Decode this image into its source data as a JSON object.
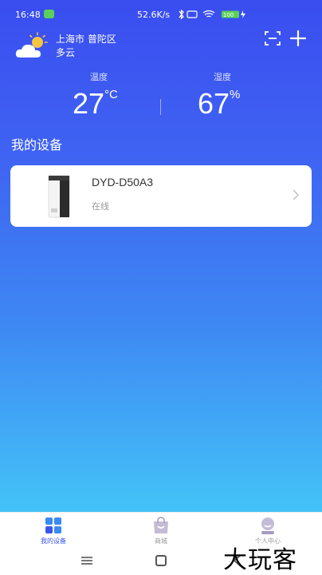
{
  "status_bar": {
    "time": "16:48",
    "network_speed": "52.6K/s",
    "battery": "100"
  },
  "weather": {
    "city": "上海市 普陀区",
    "condition": "多云",
    "icon": "partly-cloudy-icon"
  },
  "climate": {
    "temperature_label": "温度",
    "temperature_value": "27",
    "temperature_unit": "°C",
    "humidity_label": "湿度",
    "humidity_value": "67",
    "humidity_unit": "%"
  },
  "devices_section": {
    "title": "我的设备",
    "devices": [
      {
        "name": "DYD-D50A3",
        "status": "在线",
        "icon": "dehumidifier-icon"
      }
    ]
  },
  "bottom_nav": {
    "items": [
      {
        "label": "我的设备",
        "icon": "grid-icon",
        "active": true
      },
      {
        "label": "商城",
        "icon": "shopping-bag-icon",
        "active": false
      },
      {
        "label": "个人中心",
        "icon": "profile-icon",
        "active": false
      }
    ]
  },
  "watermark": "大玩客",
  "colors": {
    "gradient_top": "#3a4df0",
    "gradient_bottom": "#43c3f7",
    "active_tab": "#3a55ee"
  }
}
